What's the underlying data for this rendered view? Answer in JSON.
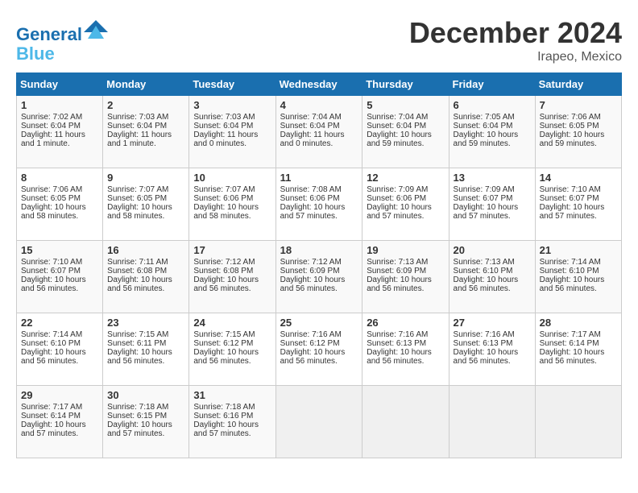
{
  "header": {
    "logo_line1": "General",
    "logo_line2": "Blue",
    "month_title": "December 2024",
    "location": "Irapeo, Mexico"
  },
  "days_of_week": [
    "Sunday",
    "Monday",
    "Tuesday",
    "Wednesday",
    "Thursday",
    "Friday",
    "Saturday"
  ],
  "weeks": [
    [
      {
        "day": "1",
        "lines": [
          "Sunrise: 7:02 AM",
          "Sunset: 6:04 PM",
          "Daylight: 11 hours",
          "and 1 minute."
        ]
      },
      {
        "day": "2",
        "lines": [
          "Sunrise: 7:03 AM",
          "Sunset: 6:04 PM",
          "Daylight: 11 hours",
          "and 1 minute."
        ]
      },
      {
        "day": "3",
        "lines": [
          "Sunrise: 7:03 AM",
          "Sunset: 6:04 PM",
          "Daylight: 11 hours",
          "and 0 minutes."
        ]
      },
      {
        "day": "4",
        "lines": [
          "Sunrise: 7:04 AM",
          "Sunset: 6:04 PM",
          "Daylight: 11 hours",
          "and 0 minutes."
        ]
      },
      {
        "day": "5",
        "lines": [
          "Sunrise: 7:04 AM",
          "Sunset: 6:04 PM",
          "Daylight: 10 hours",
          "and 59 minutes."
        ]
      },
      {
        "day": "6",
        "lines": [
          "Sunrise: 7:05 AM",
          "Sunset: 6:04 PM",
          "Daylight: 10 hours",
          "and 59 minutes."
        ]
      },
      {
        "day": "7",
        "lines": [
          "Sunrise: 7:06 AM",
          "Sunset: 6:05 PM",
          "Daylight: 10 hours",
          "and 59 minutes."
        ]
      }
    ],
    [
      {
        "day": "8",
        "lines": [
          "Sunrise: 7:06 AM",
          "Sunset: 6:05 PM",
          "Daylight: 10 hours",
          "and 58 minutes."
        ]
      },
      {
        "day": "9",
        "lines": [
          "Sunrise: 7:07 AM",
          "Sunset: 6:05 PM",
          "Daylight: 10 hours",
          "and 58 minutes."
        ]
      },
      {
        "day": "10",
        "lines": [
          "Sunrise: 7:07 AM",
          "Sunset: 6:06 PM",
          "Daylight: 10 hours",
          "and 58 minutes."
        ]
      },
      {
        "day": "11",
        "lines": [
          "Sunrise: 7:08 AM",
          "Sunset: 6:06 PM",
          "Daylight: 10 hours",
          "and 57 minutes."
        ]
      },
      {
        "day": "12",
        "lines": [
          "Sunrise: 7:09 AM",
          "Sunset: 6:06 PM",
          "Daylight: 10 hours",
          "and 57 minutes."
        ]
      },
      {
        "day": "13",
        "lines": [
          "Sunrise: 7:09 AM",
          "Sunset: 6:07 PM",
          "Daylight: 10 hours",
          "and 57 minutes."
        ]
      },
      {
        "day": "14",
        "lines": [
          "Sunrise: 7:10 AM",
          "Sunset: 6:07 PM",
          "Daylight: 10 hours",
          "and 57 minutes."
        ]
      }
    ],
    [
      {
        "day": "15",
        "lines": [
          "Sunrise: 7:10 AM",
          "Sunset: 6:07 PM",
          "Daylight: 10 hours",
          "and 56 minutes."
        ]
      },
      {
        "day": "16",
        "lines": [
          "Sunrise: 7:11 AM",
          "Sunset: 6:08 PM",
          "Daylight: 10 hours",
          "and 56 minutes."
        ]
      },
      {
        "day": "17",
        "lines": [
          "Sunrise: 7:12 AM",
          "Sunset: 6:08 PM",
          "Daylight: 10 hours",
          "and 56 minutes."
        ]
      },
      {
        "day": "18",
        "lines": [
          "Sunrise: 7:12 AM",
          "Sunset: 6:09 PM",
          "Daylight: 10 hours",
          "and 56 minutes."
        ]
      },
      {
        "day": "19",
        "lines": [
          "Sunrise: 7:13 AM",
          "Sunset: 6:09 PM",
          "Daylight: 10 hours",
          "and 56 minutes."
        ]
      },
      {
        "day": "20",
        "lines": [
          "Sunrise: 7:13 AM",
          "Sunset: 6:10 PM",
          "Daylight: 10 hours",
          "and 56 minutes."
        ]
      },
      {
        "day": "21",
        "lines": [
          "Sunrise: 7:14 AM",
          "Sunset: 6:10 PM",
          "Daylight: 10 hours",
          "and 56 minutes."
        ]
      }
    ],
    [
      {
        "day": "22",
        "lines": [
          "Sunrise: 7:14 AM",
          "Sunset: 6:10 PM",
          "Daylight: 10 hours",
          "and 56 minutes."
        ]
      },
      {
        "day": "23",
        "lines": [
          "Sunrise: 7:15 AM",
          "Sunset: 6:11 PM",
          "Daylight: 10 hours",
          "and 56 minutes."
        ]
      },
      {
        "day": "24",
        "lines": [
          "Sunrise: 7:15 AM",
          "Sunset: 6:12 PM",
          "Daylight: 10 hours",
          "and 56 minutes."
        ]
      },
      {
        "day": "25",
        "lines": [
          "Sunrise: 7:16 AM",
          "Sunset: 6:12 PM",
          "Daylight: 10 hours",
          "and 56 minutes."
        ]
      },
      {
        "day": "26",
        "lines": [
          "Sunrise: 7:16 AM",
          "Sunset: 6:13 PM",
          "Daylight: 10 hours",
          "and 56 minutes."
        ]
      },
      {
        "day": "27",
        "lines": [
          "Sunrise: 7:16 AM",
          "Sunset: 6:13 PM",
          "Daylight: 10 hours",
          "and 56 minutes."
        ]
      },
      {
        "day": "28",
        "lines": [
          "Sunrise: 7:17 AM",
          "Sunset: 6:14 PM",
          "Daylight: 10 hours",
          "and 56 minutes."
        ]
      }
    ],
    [
      {
        "day": "29",
        "lines": [
          "Sunrise: 7:17 AM",
          "Sunset: 6:14 PM",
          "Daylight: 10 hours",
          "and 57 minutes."
        ]
      },
      {
        "day": "30",
        "lines": [
          "Sunrise: 7:18 AM",
          "Sunset: 6:15 PM",
          "Daylight: 10 hours",
          "and 57 minutes."
        ]
      },
      {
        "day": "31",
        "lines": [
          "Sunrise: 7:18 AM",
          "Sunset: 6:16 PM",
          "Daylight: 10 hours",
          "and 57 minutes."
        ]
      },
      null,
      null,
      null,
      null
    ]
  ]
}
